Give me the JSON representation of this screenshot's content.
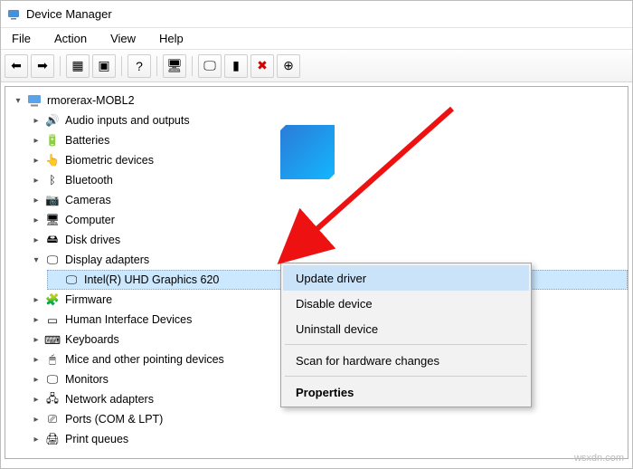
{
  "window": {
    "title": "Device Manager"
  },
  "menubar": {
    "items": [
      "File",
      "Action",
      "View",
      "Help"
    ]
  },
  "toolbar": {
    "buttons": [
      {
        "name": "back-icon",
        "glyph": "⬅",
        "interactable": true
      },
      {
        "name": "forward-icon",
        "glyph": "➡",
        "interactable": true
      },
      {
        "sep": true
      },
      {
        "name": "show-hidden-icon",
        "glyph": "▦",
        "interactable": true
      },
      {
        "name": "properties-icon",
        "glyph": "▣",
        "interactable": true
      },
      {
        "sep": true
      },
      {
        "name": "help-icon",
        "glyph": "?",
        "interactable": true
      },
      {
        "sep": true
      },
      {
        "name": "scan-icon",
        "glyph": "🖥",
        "interactable": true
      },
      {
        "sep": true
      },
      {
        "name": "update-driver-icon",
        "glyph": "🖵",
        "interactable": true
      },
      {
        "name": "uninstall-icon",
        "glyph": "▮",
        "interactable": true
      },
      {
        "name": "disable-icon",
        "glyph": "✖",
        "color": "#d40000",
        "interactable": true
      },
      {
        "name": "enable-icon",
        "glyph": "⊕",
        "interactable": true
      }
    ]
  },
  "tree": {
    "root": "rmorerax-MOBL2",
    "categories": [
      {
        "id": "audio",
        "label": "Audio inputs and outputs",
        "icon": "🔊"
      },
      {
        "id": "batteries",
        "label": "Batteries",
        "icon": "🔋"
      },
      {
        "id": "biometric",
        "label": "Biometric devices",
        "icon": "👆"
      },
      {
        "id": "bluetooth",
        "label": "Bluetooth",
        "icon": "ᛒ"
      },
      {
        "id": "cameras",
        "label": "Cameras",
        "icon": "📷"
      },
      {
        "id": "computer",
        "label": "Computer",
        "icon": "🖥"
      },
      {
        "id": "disk",
        "label": "Disk drives",
        "icon": "🖴"
      },
      {
        "id": "display",
        "label": "Display adapters",
        "icon": "🖵",
        "expanded": true,
        "children": [
          {
            "id": "intel620",
            "label": "Intel(R) UHD Graphics 620",
            "icon": "🖵",
            "selected": true
          }
        ]
      },
      {
        "id": "firmware",
        "label": "Firmware",
        "icon": "🧩"
      },
      {
        "id": "hid",
        "label": "Human Interface Devices",
        "icon": "▭"
      },
      {
        "id": "keyboards",
        "label": "Keyboards",
        "icon": "⌨"
      },
      {
        "id": "mice",
        "label": "Mice and other pointing devices",
        "icon": "🖱"
      },
      {
        "id": "monitors",
        "label": "Monitors",
        "icon": "🖵"
      },
      {
        "id": "network",
        "label": "Network adapters",
        "icon": "🖧"
      },
      {
        "id": "ports",
        "label": "Ports (COM & LPT)",
        "icon": "⎚"
      },
      {
        "id": "print",
        "label": "Print queues",
        "icon": "🖨"
      }
    ]
  },
  "context_menu": {
    "items": [
      {
        "id": "update",
        "label": "Update driver",
        "highlight": true
      },
      {
        "id": "disable",
        "label": "Disable device"
      },
      {
        "id": "uninstall",
        "label": "Uninstall device"
      },
      {
        "sep": true
      },
      {
        "id": "scan",
        "label": "Scan for hardware changes"
      },
      {
        "sep": true
      },
      {
        "id": "properties",
        "label": "Properties",
        "bold": true
      }
    ]
  },
  "watermark": "wsxdn.com",
  "colors": {
    "highlight": "#cbe3f8",
    "treeSelection": "#cce8ff"
  }
}
